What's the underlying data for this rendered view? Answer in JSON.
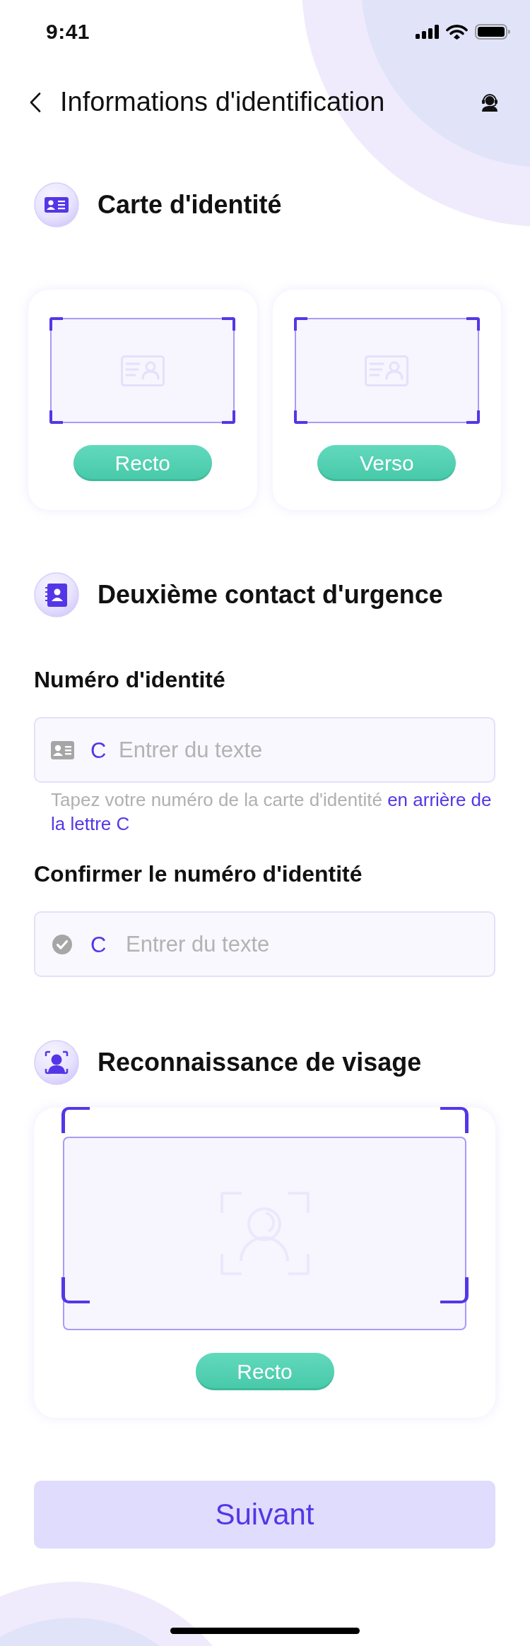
{
  "status_bar": {
    "time": "9:41"
  },
  "header": {
    "title": "Informations d'identification"
  },
  "sections": [
    {
      "kind": "id_card",
      "title": "Carte d'identité",
      "slots": [
        {
          "button": "Recto"
        },
        {
          "button": "Verso"
        }
      ]
    },
    {
      "kind": "contact",
      "title": "Deuxième contact d'urgence",
      "fields": [
        {
          "kind": "id_number",
          "label": "Numéro d'identité",
          "prefix": "C",
          "placeholder": "Entrer du texte",
          "hint": "Tapez votre numéro de la carte d'identité",
          "hint_highlight": "en arrière de la lettre C"
        },
        {
          "kind": "confirm",
          "label": "Confirmer le numéro d'identité",
          "prefix": "C",
          "placeholder": "Entrer du texte"
        }
      ]
    },
    {
      "kind": "face",
      "title": "Reconnaissance de visage",
      "button": "Recto"
    }
  ],
  "footer": {
    "button": "Suivant"
  }
}
